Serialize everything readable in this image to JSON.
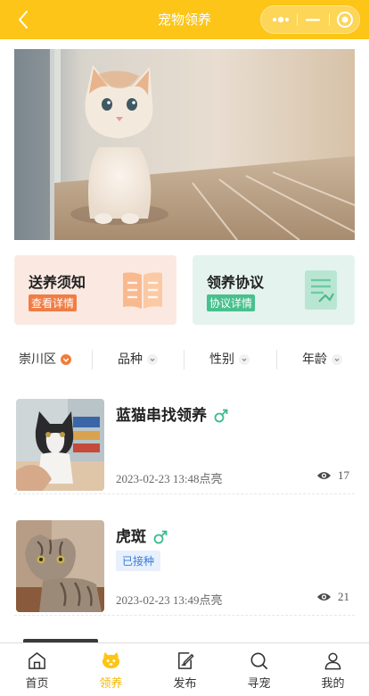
{
  "nav": {
    "title": "宠物领养"
  },
  "cards": [
    {
      "title": "送养须知",
      "tag": "查看详情"
    },
    {
      "title": "领养协议",
      "tag": "协议详情"
    }
  ],
  "filters": [
    {
      "label": "崇川区",
      "selected": true
    },
    {
      "label": "品种"
    },
    {
      "label": "性别"
    },
    {
      "label": "年龄"
    }
  ],
  "list": [
    {
      "title": "蓝猫串找领养",
      "gender": "male",
      "time": "2023-02-23 13:48点亮",
      "views": "17"
    },
    {
      "title": "虎斑",
      "gender": "male",
      "badge": "已接种",
      "time": "2023-02-23 13:49点亮",
      "views": "21"
    }
  ],
  "tabs": [
    {
      "label": "首页",
      "icon": "home-icon"
    },
    {
      "label": "领养",
      "icon": "pet-face-icon",
      "active": true
    },
    {
      "label": "发布",
      "icon": "edit-icon"
    },
    {
      "label": "寻宠",
      "icon": "search-icon"
    },
    {
      "label": "我的",
      "icon": "user-icon"
    }
  ],
  "colors": {
    "nav": "#fcc517",
    "active_tab": "#f2b705",
    "notice_tag": "#f07d45",
    "agreement_tag": "#48c08d",
    "male": "#3dbb8c"
  }
}
